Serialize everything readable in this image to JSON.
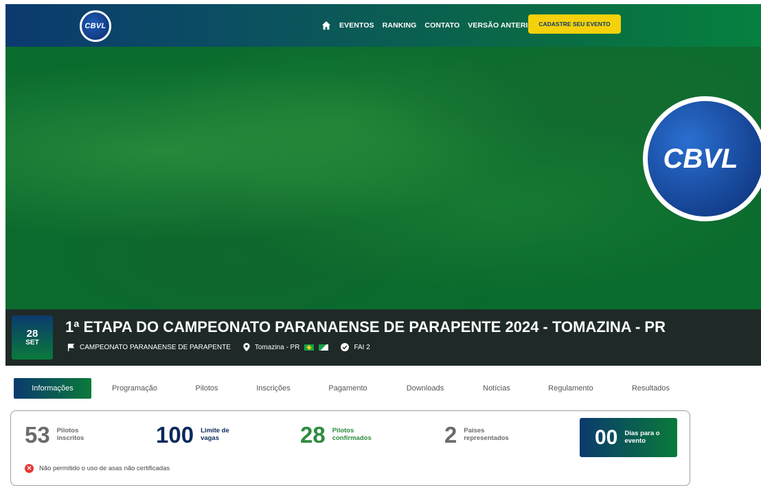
{
  "nav": {
    "logo_text": "CBVL",
    "items": [
      "EVENTOS",
      "RANKING",
      "CONTATO",
      "VERSÃO ANTERIOR"
    ],
    "cta": "CADASTRE SEU EVENTO"
  },
  "hero": {
    "logo_text": "CBVL"
  },
  "event": {
    "day": "28",
    "month": "SET",
    "title": "1ª ETAPA DO CAMPEONATO PARANAENSE DE PARAPENTE 2024 - TOMAZINA - PR",
    "championship": "CAMPEONATO PARANAENSE DE PARAPENTE",
    "location": "Tomazina - PR",
    "category": "FAI 2"
  },
  "tabs": [
    "Informações",
    "Programação",
    "Pilotos",
    "Inscrições",
    "Pagamento",
    "Downloads",
    "Notícias",
    "Regulamento",
    "Resultados"
  ],
  "stats": {
    "registered": {
      "value": "53",
      "label": "Pilotos inscritos"
    },
    "limit": {
      "value": "100",
      "label": "Limite de vagas"
    },
    "confirmed": {
      "value": "28",
      "label": "Pilotos confirmados"
    },
    "countries": {
      "value": "2",
      "label": "Países representados"
    },
    "days": {
      "value": "00",
      "label": "Dias para o evento"
    }
  },
  "warning": "Não permitido o uso de asas não certificadas",
  "colors": {
    "accent_navy": "#0b3a6e",
    "accent_green": "#0a7a3a",
    "cta_yellow": "#f5d10b"
  }
}
